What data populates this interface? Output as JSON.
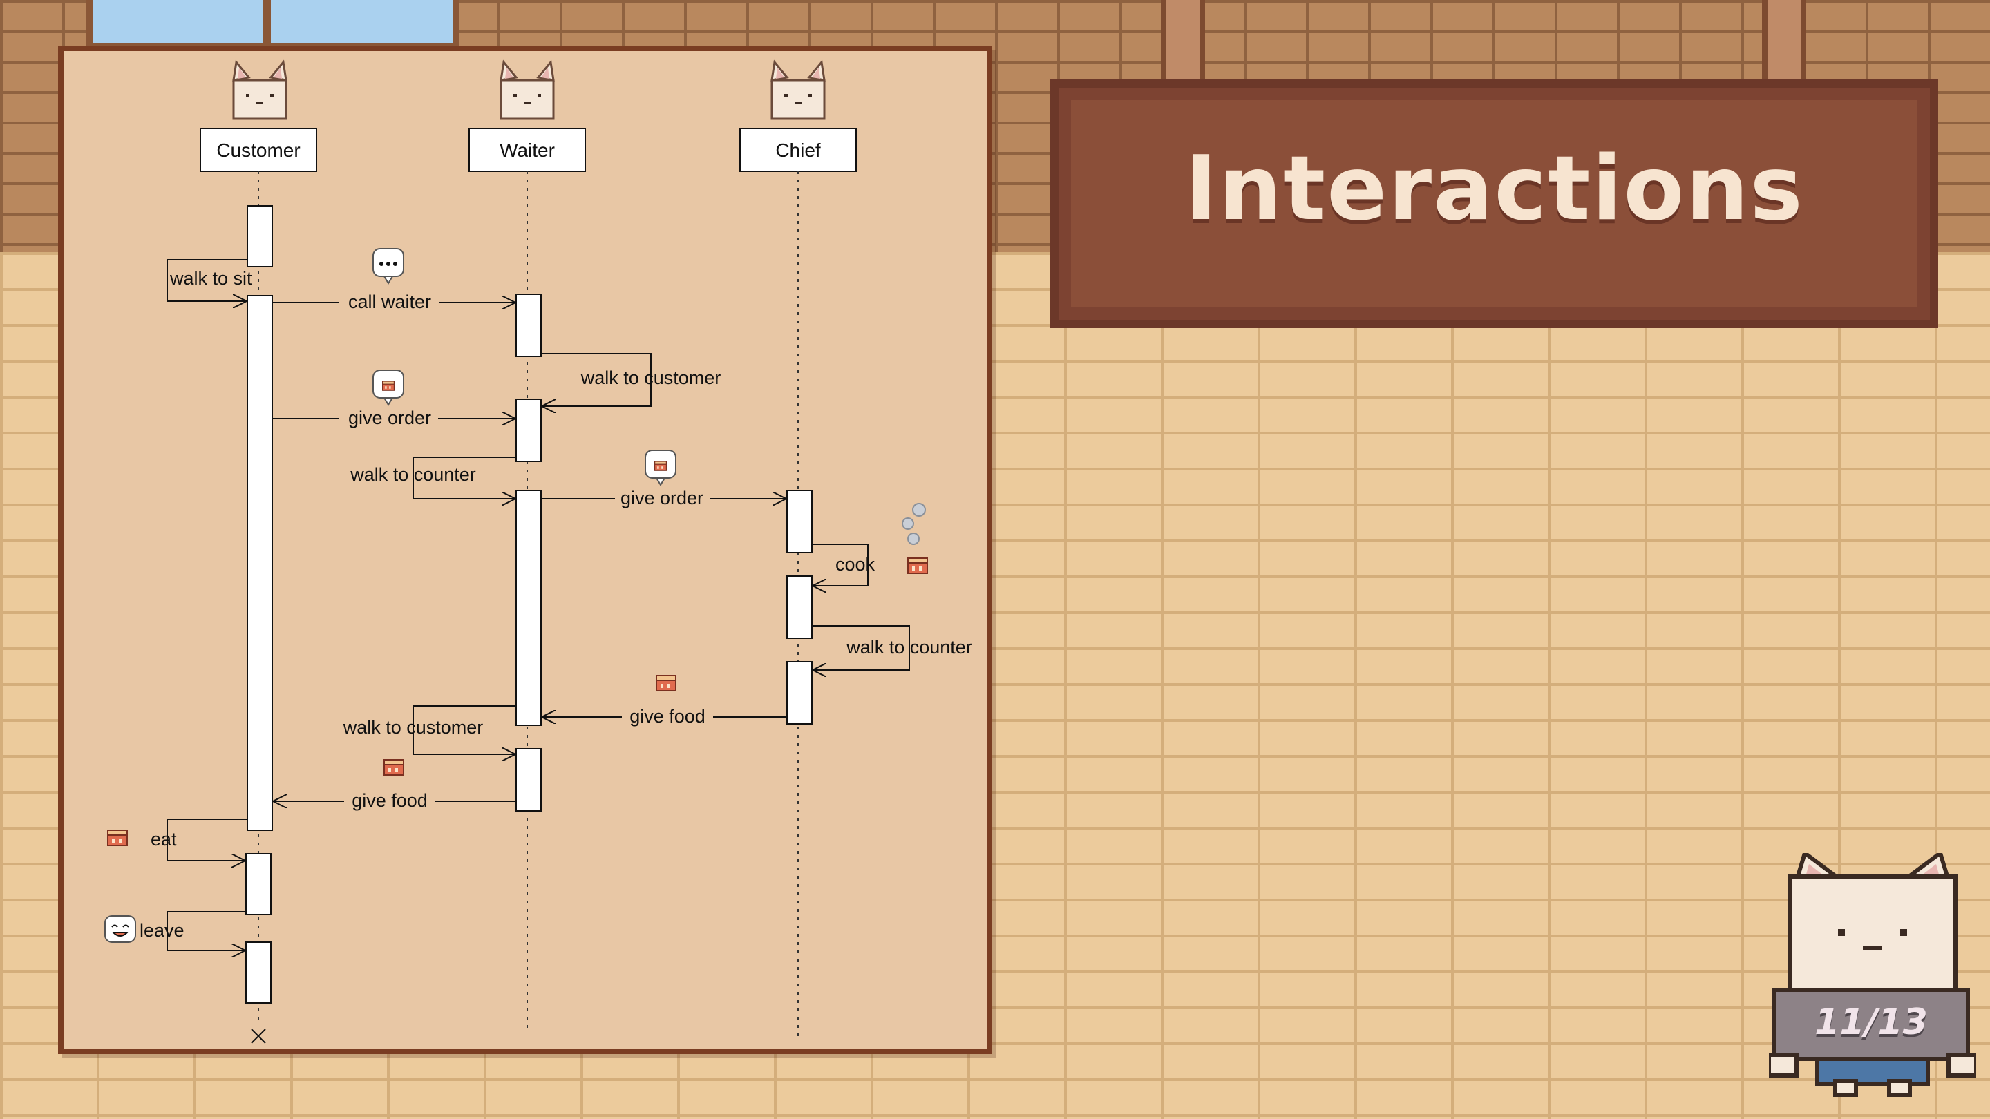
{
  "slide": {
    "title": "Interactions",
    "page_indicator": "11/13"
  },
  "diagram": {
    "lifelines": [
      {
        "id": "customer",
        "label": "Customer"
      },
      {
        "id": "waiter",
        "label": "Waiter"
      },
      {
        "id": "chief",
        "label": "Chief"
      }
    ],
    "messages": {
      "walk_to_sit": "walk to sit",
      "call_waiter": "call waiter",
      "walk_to_customer_1": "walk to customer",
      "give_order_1": "give order",
      "walk_to_counter_1": "walk to counter",
      "give_order_2": "give order",
      "cook": "cook",
      "walk_to_counter_2": "walk to counter",
      "give_food_1": "give food",
      "walk_to_customer_2": "walk to customer",
      "give_food_2": "give food",
      "eat": "eat",
      "leave": "leave"
    }
  },
  "colors": {
    "board": "#e8c7a5",
    "board_border": "#7a3d22",
    "sign": "#8b4f39",
    "sign_text": "#f7e4d0"
  }
}
